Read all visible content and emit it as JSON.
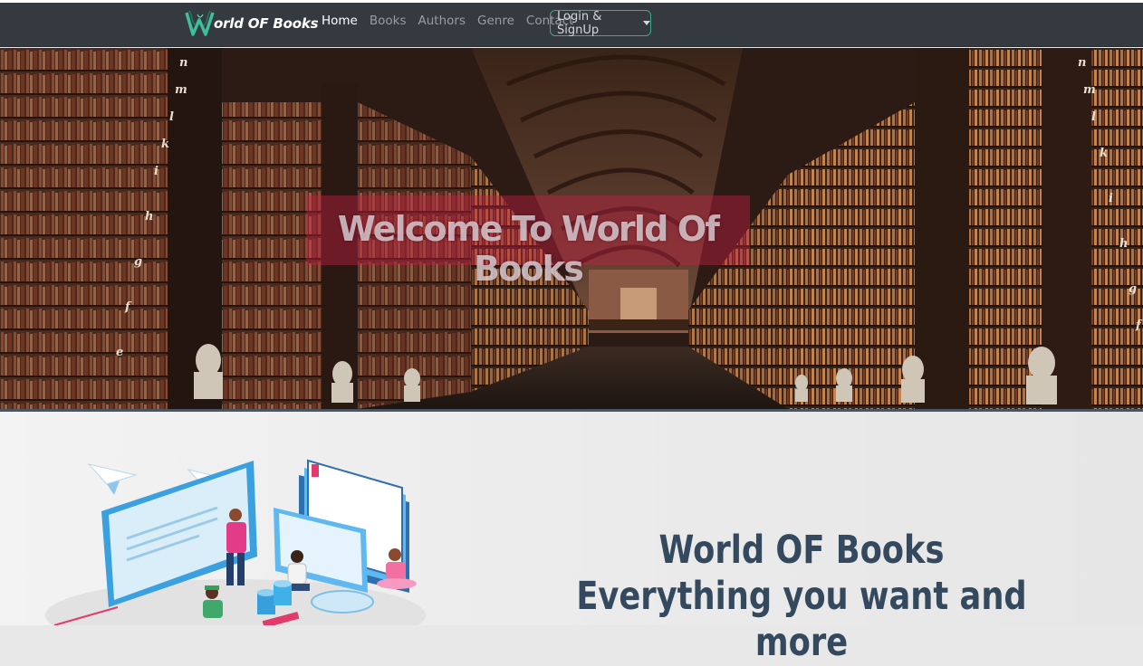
{
  "brand": {
    "logo_letter": "W",
    "name": "orld OF Books"
  },
  "nav": {
    "items": [
      {
        "label": "Home",
        "active": true
      },
      {
        "label": "Books",
        "active": false
      },
      {
        "label": "Authors",
        "active": false
      },
      {
        "label": "Genre",
        "active": false
      },
      {
        "label": "Contact",
        "active": false
      }
    ],
    "login_label": "Login & SignUp"
  },
  "hero": {
    "title": "Welcome To World Of Books"
  },
  "intro": {
    "line1": "World OF Books",
    "line2": "Everything you want and more"
  },
  "colors": {
    "navbar": "#343a40",
    "accent": "#3fa88d",
    "headline": "#34495e",
    "welcome_band": "#c81e46"
  }
}
